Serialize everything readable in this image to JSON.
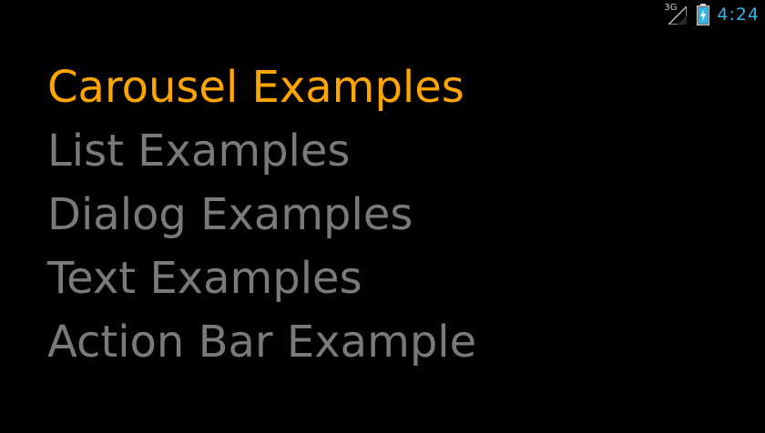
{
  "status_bar": {
    "network_type": "3G",
    "time": "4:24"
  },
  "menu": {
    "selected_index": 0,
    "items": [
      {
        "label": "Carousel Examples"
      },
      {
        "label": "List Examples"
      },
      {
        "label": "Dialog Examples"
      },
      {
        "label": "Text Examples"
      },
      {
        "label": "Action Bar Example"
      }
    ]
  },
  "colors": {
    "selected": "#ffa500",
    "unselected": "#7a7a7a",
    "clock": "#33b5e5",
    "background": "#000000"
  },
  "icons": [
    "signal-icon",
    "battery-icon"
  ]
}
